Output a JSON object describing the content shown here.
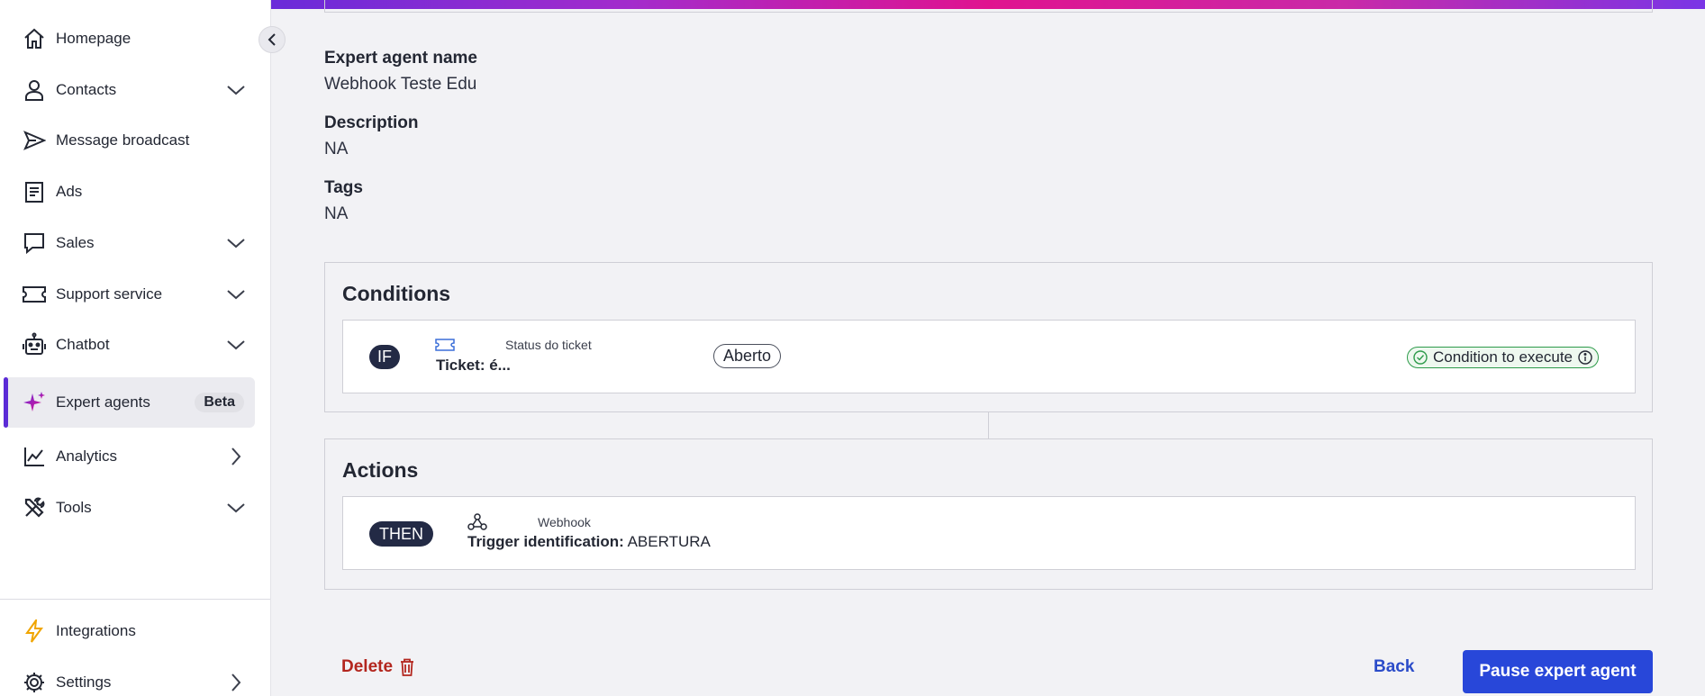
{
  "sidebar": {
    "items": [
      {
        "label": "Homepage",
        "icon": "home-icon"
      },
      {
        "label": "Contacts",
        "icon": "person-icon",
        "chevron": "down"
      },
      {
        "label": "Message broadcast",
        "icon": "send-icon"
      },
      {
        "label": "Ads",
        "icon": "document-icon"
      },
      {
        "label": "Sales",
        "icon": "chat-bubble-icon",
        "chevron": "down"
      },
      {
        "label": "Support service",
        "icon": "ticket-icon",
        "chevron": "down"
      },
      {
        "label": "Chatbot",
        "icon": "robot-icon",
        "chevron": "down"
      },
      {
        "label": "Expert agents",
        "icon": "sparkle-icon",
        "badge": "Beta",
        "active": true
      },
      {
        "label": "Analytics",
        "icon": "line-chart-icon",
        "chevron": "right"
      },
      {
        "label": "Tools",
        "icon": "tools-icon",
        "chevron": "down"
      }
    ],
    "bottom_items": [
      {
        "label": "Integrations",
        "icon": "lightning-icon"
      },
      {
        "label": "Settings",
        "icon": "gear-icon",
        "chevron": "right"
      }
    ]
  },
  "agent": {
    "name_label": "Expert agent name",
    "name_value": "Webhook Teste Edu",
    "description_label": "Description",
    "description_value": "NA",
    "tags_label": "Tags",
    "tags_value": "NA"
  },
  "conditions": {
    "title": "Conditions",
    "row": {
      "keyword": "IF",
      "field_caption": "Status do ticket",
      "field_text": "Ticket: é...",
      "value": "Aberto",
      "execute_label": "Condition to execute"
    }
  },
  "actions": {
    "title": "Actions",
    "row": {
      "keyword": "THEN",
      "type_caption": "Webhook",
      "trigger_label": "Trigger identification:",
      "trigger_value": "ABERTURA"
    }
  },
  "footer": {
    "delete_label": "Delete",
    "back_label": "Back",
    "pause_label": "Pause expert agent"
  },
  "colors": {
    "accent": "#2847d9",
    "active_indicator": "#5b2bd6",
    "danger": "#b3261e",
    "success": "#2d9b4a",
    "dark_pill": "#232a45"
  }
}
